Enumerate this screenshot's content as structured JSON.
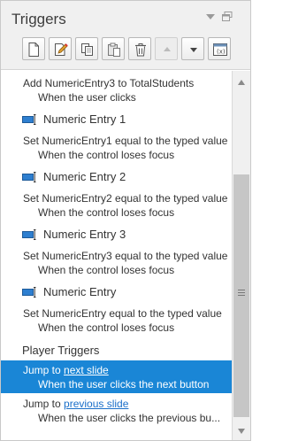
{
  "panel": {
    "title": "Triggers",
    "selected_color": "#1a86d6",
    "link_color": "#1a6fc9"
  },
  "header_controls": [
    {
      "name": "collapse-menu-icon"
    },
    {
      "name": "restore-window-icon"
    }
  ],
  "toolbar": [
    {
      "name": "new-trigger-button",
      "icon": "new-document-icon",
      "enabled": true
    },
    {
      "name": "edit-trigger-button",
      "icon": "edit-pencil-icon",
      "enabled": true
    },
    {
      "name": "copy-trigger-button",
      "icon": "copy-icon",
      "enabled": true
    },
    {
      "name": "paste-trigger-button",
      "icon": "paste-icon",
      "enabled": true
    },
    {
      "name": "delete-trigger-button",
      "icon": "trash-icon",
      "enabled": true
    },
    {
      "name": "move-up-button",
      "icon": "triangle-up-icon",
      "enabled": false
    },
    {
      "name": "move-down-button",
      "icon": "triangle-down-icon",
      "enabled": true
    },
    {
      "name": "variables-button",
      "icon": "variables-window-icon",
      "enabled": true
    }
  ],
  "triggers": {
    "top_partial": {
      "action": "Add NumericEntry3 to TotalStudents",
      "condition": "When the user clicks"
    },
    "groups": [
      {
        "name": "Numeric Entry 1",
        "action": "Set NumericEntry1 equal to the typed value",
        "condition": "When the control loses focus"
      },
      {
        "name": "Numeric Entry 2",
        "action": "Set NumericEntry2 equal to the typed value",
        "condition": "When the control loses focus"
      },
      {
        "name": "Numeric Entry 3",
        "action": "Set NumericEntry3 equal to the typed value",
        "condition": "When the control loses focus"
      },
      {
        "name": "Numeric Entry",
        "action": "Set NumericEntry equal to the typed value",
        "condition": "When the control loses focus"
      }
    ],
    "player_section": "Player Triggers",
    "player": [
      {
        "action_prefix": "Jump to ",
        "action_link": "next slide",
        "condition": "When the user clicks the next button",
        "selected": true
      },
      {
        "action_prefix": "Jump to ",
        "action_link": "previous slide",
        "condition": "When the user clicks the previous bu...",
        "selected": false
      }
    ]
  }
}
